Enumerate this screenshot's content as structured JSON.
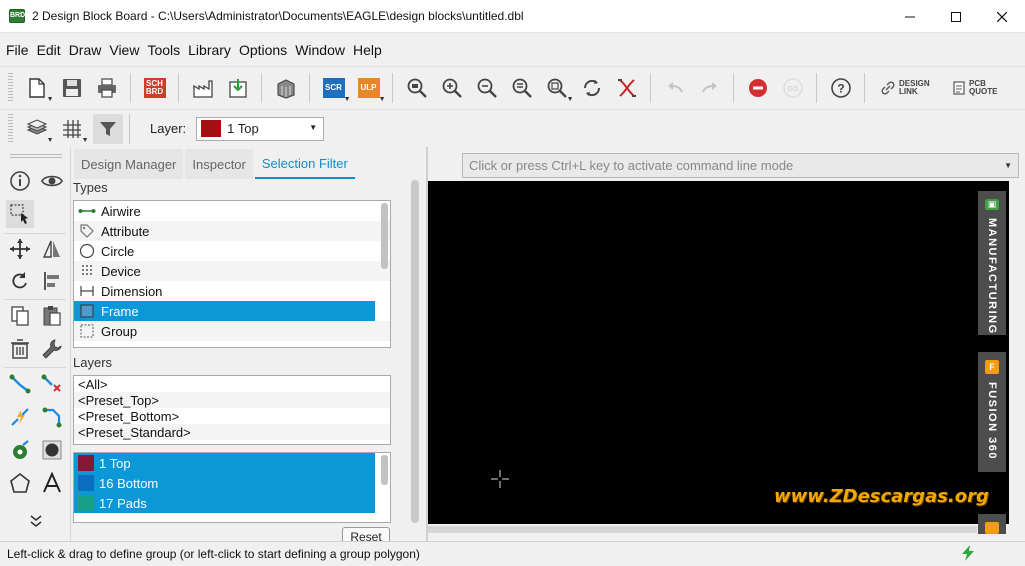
{
  "window": {
    "title": "2 Design Block Board - C:\\Users\\Administrator\\Documents\\EAGLE\\design blocks\\untitled.dbl",
    "app_icon_text": "BRD"
  },
  "menu": [
    "File",
    "Edit",
    "Draw",
    "View",
    "Tools",
    "Library",
    "Options",
    "Window",
    "Help"
  ],
  "toolbar": {
    "sch_brd_label": "SCH BRD",
    "scr_label": "SCR",
    "ulp_label": "ULP",
    "design_link": "DESIGN LINK",
    "pcb_quote": "PCB QUOTE",
    "disabled_badge": "GO"
  },
  "layer_toolbar": {
    "label": "Layer:",
    "selected": "1 Top",
    "selected_color": "#a40f0f"
  },
  "panel": {
    "tabs": [
      "Design Manager",
      "Inspector",
      "Selection Filter"
    ],
    "active_tab": "Selection Filter",
    "types_label": "Types",
    "types": [
      {
        "label": "Airwire",
        "icon": "airwire-icon"
      },
      {
        "label": "Attribute",
        "icon": "tag-icon"
      },
      {
        "label": "Circle",
        "icon": "circle-icon"
      },
      {
        "label": "Device",
        "icon": "device-icon"
      },
      {
        "label": "Dimension",
        "icon": "dimension-icon"
      },
      {
        "label": "Frame",
        "icon": "frame-icon",
        "selected": true
      },
      {
        "label": "Group",
        "icon": "group-icon"
      }
    ],
    "layers_label": "Layers",
    "presets": [
      "<All>",
      "<Preset_Top>",
      "<Preset_Bottom>",
      "<Preset_Standard>"
    ],
    "layers": [
      {
        "label": "1 Top",
        "color": "#8b1538"
      },
      {
        "label": "16 Bottom",
        "color": "#0a6fc0"
      },
      {
        "label": "17 Pads",
        "color": "#16a08a"
      }
    ],
    "reset_label": "Reset"
  },
  "command_line": {
    "placeholder": "Click or press Ctrl+L key to activate command line mode"
  },
  "right_rail": {
    "manufacturing": "MANUFACTURING",
    "fusion": "FUSION 360"
  },
  "watermark": "www.ZDescargas.org",
  "status": {
    "message": "Left-click & drag to define group (or left-click to start defining a group polygon)"
  },
  "colors": {
    "accent": "#0c97d6",
    "canvas": "#000000",
    "watermark": "#f1a800"
  }
}
